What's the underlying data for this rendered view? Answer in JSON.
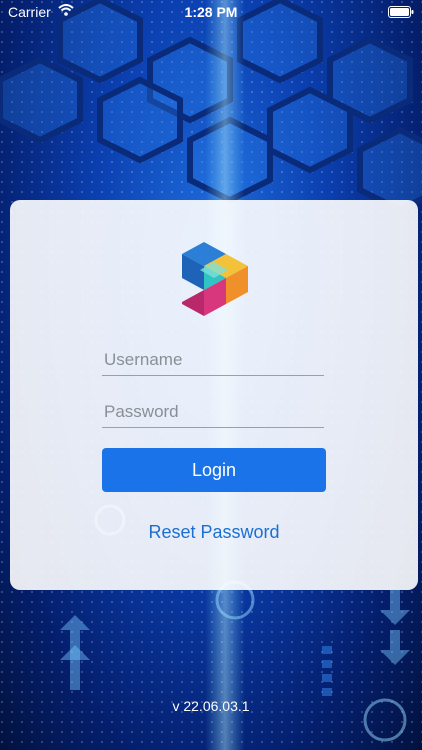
{
  "status_bar": {
    "carrier": "Carrier",
    "time": "1:28 PM"
  },
  "login": {
    "username_placeholder": "Username",
    "password_placeholder": "Password",
    "login_label": "Login",
    "reset_label": "Reset Password"
  },
  "footer": {
    "version": "v 22.06.03.1"
  },
  "colors": {
    "accent": "#1a73e8",
    "link": "#1a6fd1",
    "logo_blue": "#2b7fd6",
    "logo_teal": "#2ec4c4",
    "logo_pink": "#d8377d",
    "logo_orange": "#f0902a",
    "logo_yellow": "#f3c23a"
  },
  "icons": {
    "wifi": "wifi-icon",
    "battery": "battery-icon",
    "logo": "app-logo"
  }
}
